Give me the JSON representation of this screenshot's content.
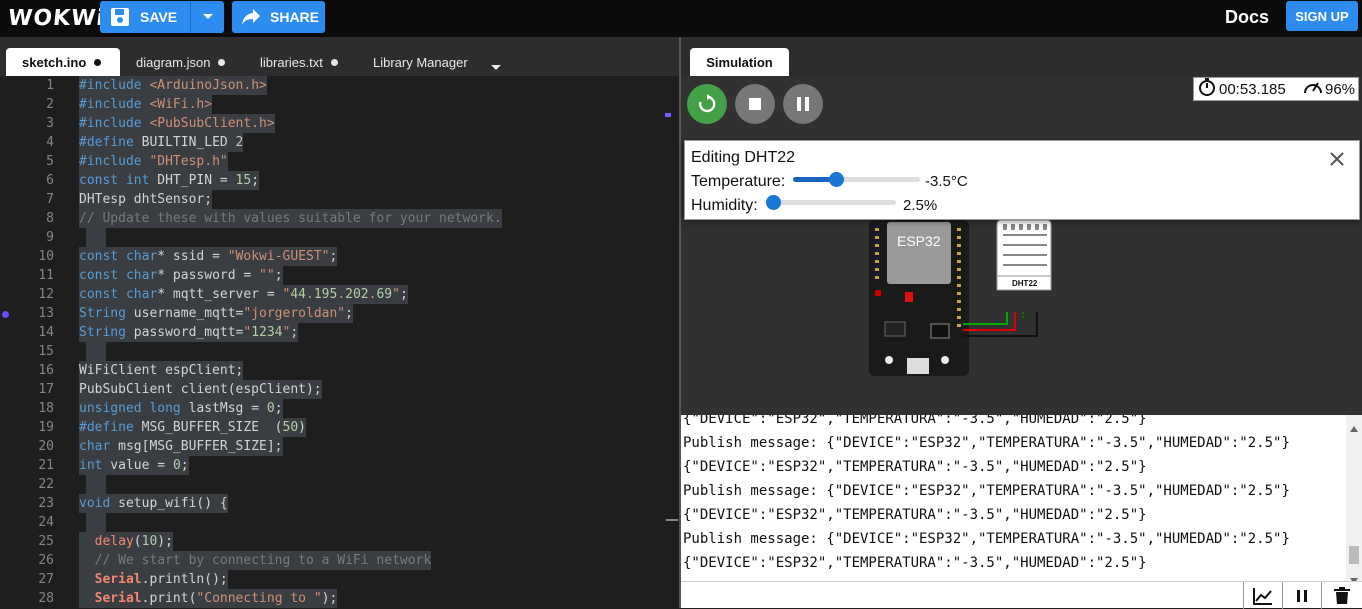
{
  "header": {
    "logo": "WOKWi",
    "save_label": "SAVE",
    "share_label": "SHARE",
    "docs_label": "Docs",
    "signup_label": "SIGN UP"
  },
  "editor_tabs": [
    {
      "label": "sketch.ino"
    },
    {
      "label": "diagram.json"
    },
    {
      "label": "libraries.txt"
    },
    {
      "label": "Library Manager"
    }
  ],
  "code_lines": [
    "#include <ArduinoJson.h>",
    "#include <WiFi.h>",
    "#include <PubSubClient.h>",
    "#define BUILTIN_LED 2",
    "#include \"DHTesp.h\"",
    "const int DHT_PIN = 15;",
    "DHTesp dhtSensor;",
    "// Update these with values suitable for your network.",
    "",
    "const char* ssid = \"Wokwi-GUEST\";",
    "const char* password = \"\";",
    "const char* mqtt_server = \"44.195.202.69\";",
    "String username_mqtt=\"jorgeroldan\";",
    "String password_mqtt=\"1234\";",
    "",
    "WiFiClient espClient;",
    "PubSubClient client(espClient);",
    "unsigned long lastMsg = 0;",
    "#define MSG_BUFFER_SIZE  (50)",
    "char msg[MSG_BUFFER_SIZE];",
    "int value = 0;",
    "",
    "void setup_wifi() {",
    "",
    "  delay(10);",
    "  // We start by connecting to a WiFi network",
    "  Serial.println();",
    "  Serial.print(\"Connecting to \");"
  ],
  "line_numbers": [
    "1",
    "2",
    "3",
    "4",
    "5",
    "6",
    "7",
    "8",
    "9",
    "10",
    "11",
    "12",
    "13",
    "14",
    "15",
    "16",
    "17",
    "18",
    "19",
    "20",
    "21",
    "22",
    "23",
    "24",
    "25",
    "26",
    "27",
    "28"
  ],
  "simulation": {
    "tab_label": "Simulation",
    "timer": "00:53.185",
    "speed": "96%"
  },
  "dht_dialog": {
    "title": "Editing DHT22",
    "temperature_label": "Temperature:",
    "temperature_value": "-3.5°C",
    "temperature_fraction": 0.34,
    "humidity_label": "Humidity:",
    "humidity_value": "2.5%",
    "humidity_fraction": 0.03
  },
  "board": {
    "chip_label": "ESP32",
    "sensor_label": "DHT22"
  },
  "serial_lines": [
    "{\"DEVICE\":\"ESP32\",\"TEMPERATURA\":\"-3.5\",\"HUMEDAD\":\"2.5\"}",
    "Publish message: {\"DEVICE\":\"ESP32\",\"TEMPERATURA\":\"-3.5\",\"HUMEDAD\":\"2.5\"}",
    "{\"DEVICE\":\"ESP32\",\"TEMPERATURA\":\"-3.5\",\"HUMEDAD\":\"2.5\"}",
    "Publish message: {\"DEVICE\":\"ESP32\",\"TEMPERATURA\":\"-3.5\",\"HUMEDAD\":\"2.5\"}",
    "{\"DEVICE\":\"ESP32\",\"TEMPERATURA\":\"-3.5\",\"HUMEDAD\":\"2.5\"}",
    "Publish message: {\"DEVICE\":\"ESP32\",\"TEMPERATURA\":\"-3.5\",\"HUMEDAD\":\"2.5\"}",
    "{\"DEVICE\":\"ESP32\",\"TEMPERATURA\":\"-3.5\",\"HUMEDAD\":\"2.5\"}"
  ],
  "colors": {
    "accent": "#2d8cf0",
    "restart": "#43a047",
    "control_grey": "#777777"
  }
}
